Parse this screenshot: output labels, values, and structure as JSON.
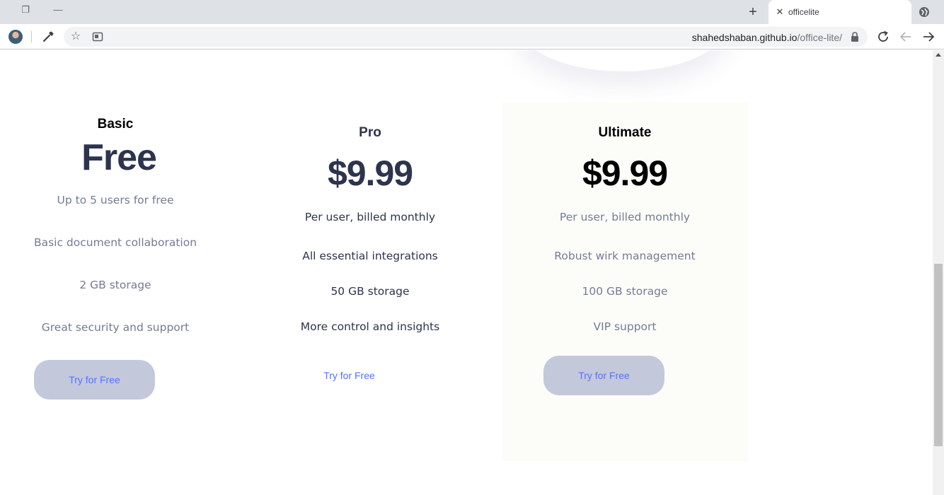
{
  "browser": {
    "tab_title": "officelite",
    "url_host": "shahedshaban.github.io",
    "url_path": "/office-lite/"
  },
  "plans": [
    {
      "name": "Basic",
      "price": "Free",
      "features": [
        "Up to 5 users for free",
        "Basic document collaboration",
        "2 GB storage",
        "Great security and support"
      ],
      "cta": "Try for Free"
    },
    {
      "name": "Pro",
      "price": "$9.99",
      "features": [
        "Per user, billed monthly",
        "All essential integrations",
        "50 GB storage",
        "More control and insights"
      ],
      "cta": "Try for Free"
    },
    {
      "name": "Ultimate",
      "price": "$9.99",
      "features": [
        "Per user, billed monthly",
        "Robust wirk management",
        "100 GB storage",
        "VIP support"
      ],
      "cta": "Try for Free"
    }
  ],
  "colors": {
    "heading_dark": "#2c344e",
    "text_muted": "#747b95",
    "accent": "#5175ff",
    "button_bg": "#c4c8db"
  }
}
